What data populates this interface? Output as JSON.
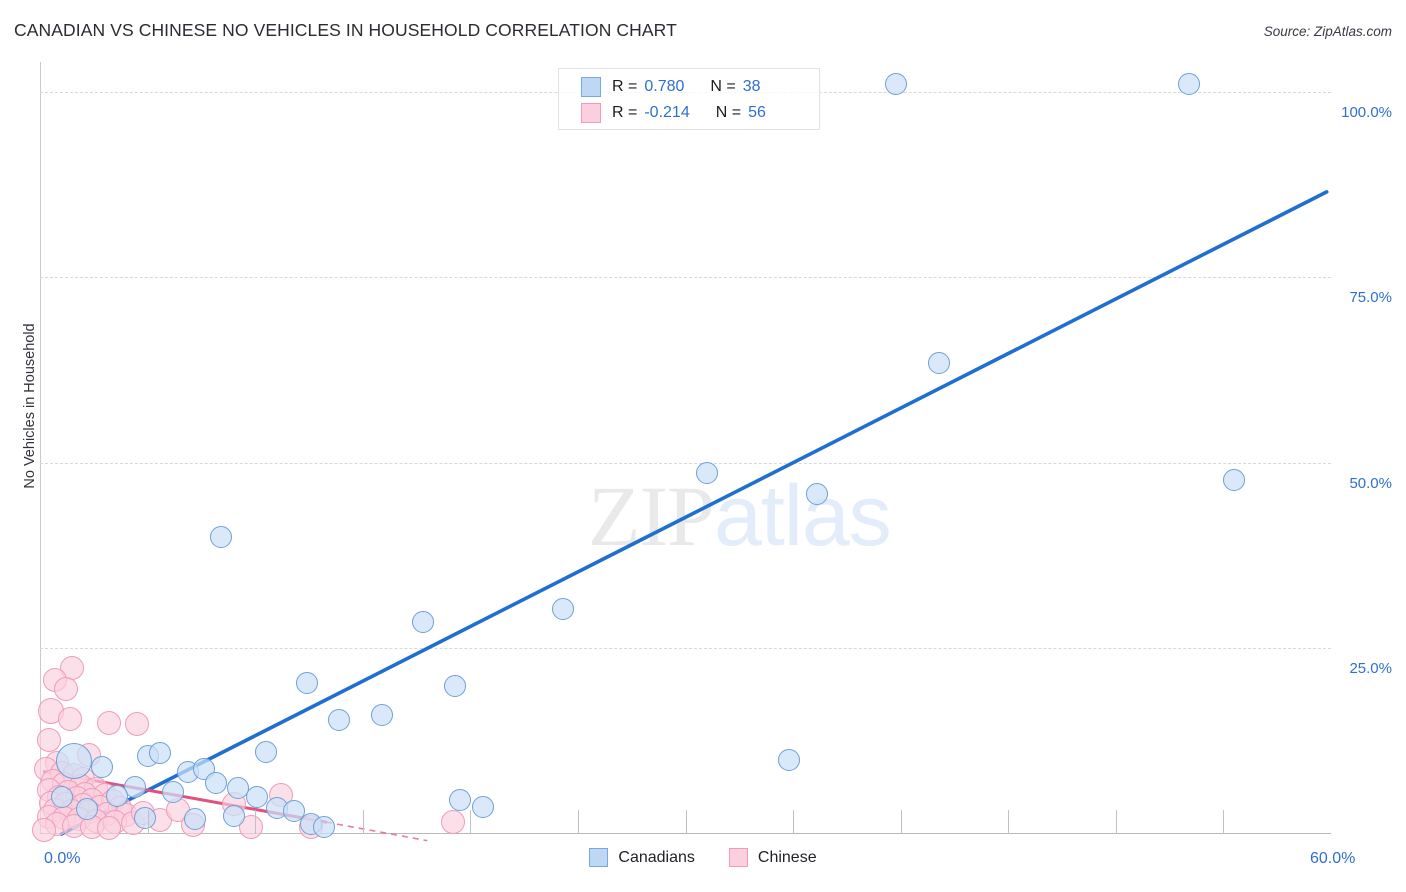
{
  "header": {
    "title": "CANADIAN VS CHINESE NO VEHICLES IN HOUSEHOLD CORRELATION CHART",
    "source": "Source: ZipAtlas.com"
  },
  "watermark": {
    "part1": "ZIP",
    "part2": "atlas"
  },
  "axes": {
    "y_title": "No Vehicles in Household",
    "y_ticks": [
      "25.0%",
      "50.0%",
      "75.0%",
      "100.0%"
    ],
    "x_ticks": [
      "0.0%",
      "60.0%"
    ]
  },
  "stats_legend": {
    "rows": [
      {
        "color": "#bdd7f5",
        "r_label": "R =",
        "r_value": "0.780",
        "n_label": "N =",
        "n_value": "38"
      },
      {
        "color": "#fbd0de",
        "r_label": "R =",
        "r_value": "-0.214",
        "n_label": "N =",
        "n_value": "56"
      }
    ]
  },
  "series_legend": [
    {
      "label": "Canadians",
      "color": "#bdd7f5"
    },
    {
      "label": "Chinese",
      "color": "#fbd0de"
    }
  ],
  "colors": {
    "blue_fill": "#cbe1f8",
    "blue_stroke": "#6f9fd8",
    "pink_fill": "#fad0dd",
    "pink_stroke": "#ef9cb8",
    "trend_blue": "#1f6fd0",
    "trend_pink": "#e0517f",
    "tick_text": "#2f6fd0",
    "grid": "#d8d8dc"
  },
  "chart_data": {
    "type": "scatter",
    "title": "CANADIAN VS CHINESE NO VEHICLES IN HOUSEHOLD CORRELATION CHART",
    "xlabel": "",
    "ylabel": "No Vehicles in Household",
    "xlim": [
      0,
      60
    ],
    "ylim": [
      0,
      104
    ],
    "x_tick_values": [
      0,
      60
    ],
    "y_tick_values": [
      25,
      50,
      75,
      100
    ],
    "grid": true,
    "legend_position": "bottom-center",
    "series": [
      {
        "name": "Canadians",
        "color": "#cbe1f8",
        "r": 0.78,
        "n": 38,
        "trendline": {
          "x0": 1.0,
          "y0": 0.0,
          "x1": 59.8,
          "y1": 86.5,
          "style": "solid"
        },
        "points": [
          {
            "x": 39.8,
            "y": 101.0,
            "r": 11
          },
          {
            "x": 53.4,
            "y": 101.0,
            "r": 11
          },
          {
            "x": 41.8,
            "y": 63.5,
            "r": 11
          },
          {
            "x": 31.0,
            "y": 48.6,
            "r": 11
          },
          {
            "x": 36.1,
            "y": 45.8,
            "r": 11
          },
          {
            "x": 55.5,
            "y": 47.7,
            "r": 11
          },
          {
            "x": 8.4,
            "y": 40.0,
            "r": 11
          },
          {
            "x": 24.3,
            "y": 30.3,
            "r": 11
          },
          {
            "x": 17.8,
            "y": 28.5,
            "r": 11
          },
          {
            "x": 19.3,
            "y": 20.0,
            "r": 11
          },
          {
            "x": 12.4,
            "y": 20.4,
            "r": 11
          },
          {
            "x": 13.9,
            "y": 15.4,
            "r": 11
          },
          {
            "x": 15.9,
            "y": 16.0,
            "r": 11
          },
          {
            "x": 34.8,
            "y": 10.0,
            "r": 11
          },
          {
            "x": 10.5,
            "y": 11.0,
            "r": 11
          },
          {
            "x": 19.5,
            "y": 4.6,
            "r": 11
          },
          {
            "x": 20.6,
            "y": 3.6,
            "r": 11
          },
          {
            "x": 5.0,
            "y": 10.5,
            "r": 11
          },
          {
            "x": 5.6,
            "y": 10.9,
            "r": 11
          },
          {
            "x": 2.9,
            "y": 9.0,
            "r": 11
          },
          {
            "x": 6.9,
            "y": 8.3,
            "r": 11
          },
          {
            "x": 7.6,
            "y": 8.7,
            "r": 11
          },
          {
            "x": 8.2,
            "y": 6.9,
            "r": 11
          },
          {
            "x": 9.2,
            "y": 6.2,
            "r": 11
          },
          {
            "x": 10.1,
            "y": 5.0,
            "r": 11
          },
          {
            "x": 6.2,
            "y": 5.6,
            "r": 11
          },
          {
            "x": 4.4,
            "y": 6.3,
            "r": 11
          },
          {
            "x": 3.6,
            "y": 5.1,
            "r": 11
          },
          {
            "x": 11.0,
            "y": 3.5,
            "r": 11
          },
          {
            "x": 11.8,
            "y": 3.1,
            "r": 11
          },
          {
            "x": 9.0,
            "y": 2.4,
            "r": 11
          },
          {
            "x": 7.2,
            "y": 2.0,
            "r": 11
          },
          {
            "x": 12.6,
            "y": 1.3,
            "r": 11
          },
          {
            "x": 1.6,
            "y": 9.8,
            "r": 18
          },
          {
            "x": 2.2,
            "y": 3.4,
            "r": 11
          },
          {
            "x": 4.9,
            "y": 2.2,
            "r": 11
          },
          {
            "x": 13.2,
            "y": 1.0,
            "r": 11
          },
          {
            "x": 1.0,
            "y": 5.0,
            "r": 11
          }
        ]
      },
      {
        "name": "Chinese",
        "color": "#fad0dd",
        "r": -0.214,
        "n": 56,
        "trendline": {
          "x0": 0.2,
          "y0": 8.4,
          "x1": 13.3,
          "y1": 1.6,
          "style": "solid",
          "dash_x1": 18.0,
          "dash_y1": -0.9
        },
        "points": [
          {
            "x": 1.5,
            "y": 22.3,
            "r": 12
          },
          {
            "x": 0.7,
            "y": 20.8,
            "r": 12
          },
          {
            "x": 1.2,
            "y": 19.6,
            "r": 12
          },
          {
            "x": 0.5,
            "y": 16.6,
            "r": 13
          },
          {
            "x": 1.4,
            "y": 15.5,
            "r": 12
          },
          {
            "x": 3.2,
            "y": 15.0,
            "r": 12
          },
          {
            "x": 4.5,
            "y": 14.8,
            "r": 12
          },
          {
            "x": 0.4,
            "y": 12.7,
            "r": 12
          },
          {
            "x": 2.3,
            "y": 10.6,
            "r": 12
          },
          {
            "x": 0.8,
            "y": 9.6,
            "r": 12
          },
          {
            "x": 0.3,
            "y": 8.8,
            "r": 12
          },
          {
            "x": 1.0,
            "y": 8.2,
            "r": 12
          },
          {
            "x": 1.6,
            "y": 7.9,
            "r": 12
          },
          {
            "x": 2.0,
            "y": 7.4,
            "r": 12
          },
          {
            "x": 0.6,
            "y": 7.1,
            "r": 12
          },
          {
            "x": 1.1,
            "y": 6.7,
            "r": 12
          },
          {
            "x": 1.9,
            "y": 6.4,
            "r": 12
          },
          {
            "x": 2.6,
            "y": 6.1,
            "r": 12
          },
          {
            "x": 0.4,
            "y": 5.9,
            "r": 12
          },
          {
            "x": 1.3,
            "y": 5.6,
            "r": 12
          },
          {
            "x": 2.1,
            "y": 5.4,
            "r": 12
          },
          {
            "x": 3.0,
            "y": 5.2,
            "r": 12
          },
          {
            "x": 0.9,
            "y": 5.0,
            "r": 12
          },
          {
            "x": 1.7,
            "y": 4.8,
            "r": 12
          },
          {
            "x": 2.4,
            "y": 4.6,
            "r": 12
          },
          {
            "x": 3.4,
            "y": 4.4,
            "r": 12
          },
          {
            "x": 0.5,
            "y": 4.2,
            "r": 12
          },
          {
            "x": 1.2,
            "y": 4.0,
            "r": 12
          },
          {
            "x": 2.0,
            "y": 3.9,
            "r": 12
          },
          {
            "x": 2.8,
            "y": 3.7,
            "r": 12
          },
          {
            "x": 3.7,
            "y": 3.5,
            "r": 12
          },
          {
            "x": 0.7,
            "y": 3.3,
            "r": 12
          },
          {
            "x": 1.5,
            "y": 3.1,
            "r": 12
          },
          {
            "x": 2.3,
            "y": 2.9,
            "r": 12
          },
          {
            "x": 3.1,
            "y": 2.7,
            "r": 12
          },
          {
            "x": 4.0,
            "y": 2.5,
            "r": 12
          },
          {
            "x": 0.4,
            "y": 2.3,
            "r": 12
          },
          {
            "x": 1.1,
            "y": 2.1,
            "r": 12
          },
          {
            "x": 1.8,
            "y": 2.0,
            "r": 12
          },
          {
            "x": 2.6,
            "y": 1.8,
            "r": 12
          },
          {
            "x": 3.5,
            "y": 1.6,
            "r": 12
          },
          {
            "x": 4.3,
            "y": 1.5,
            "r": 12
          },
          {
            "x": 0.8,
            "y": 1.3,
            "r": 12
          },
          {
            "x": 1.6,
            "y": 1.1,
            "r": 12
          },
          {
            "x": 2.4,
            "y": 0.9,
            "r": 12
          },
          {
            "x": 3.2,
            "y": 0.8,
            "r": 12
          },
          {
            "x": 4.8,
            "y": 2.8,
            "r": 12
          },
          {
            "x": 5.6,
            "y": 1.9,
            "r": 12
          },
          {
            "x": 6.4,
            "y": 3.3,
            "r": 12
          },
          {
            "x": 7.1,
            "y": 1.2,
            "r": 12
          },
          {
            "x": 9.0,
            "y": 4.0,
            "r": 12
          },
          {
            "x": 9.8,
            "y": 1.0,
            "r": 12
          },
          {
            "x": 11.2,
            "y": 5.3,
            "r": 12
          },
          {
            "x": 12.6,
            "y": 0.9,
            "r": 12
          },
          {
            "x": 19.2,
            "y": 1.6,
            "r": 12
          },
          {
            "x": 0.2,
            "y": 0.6,
            "r": 12
          }
        ]
      }
    ]
  }
}
